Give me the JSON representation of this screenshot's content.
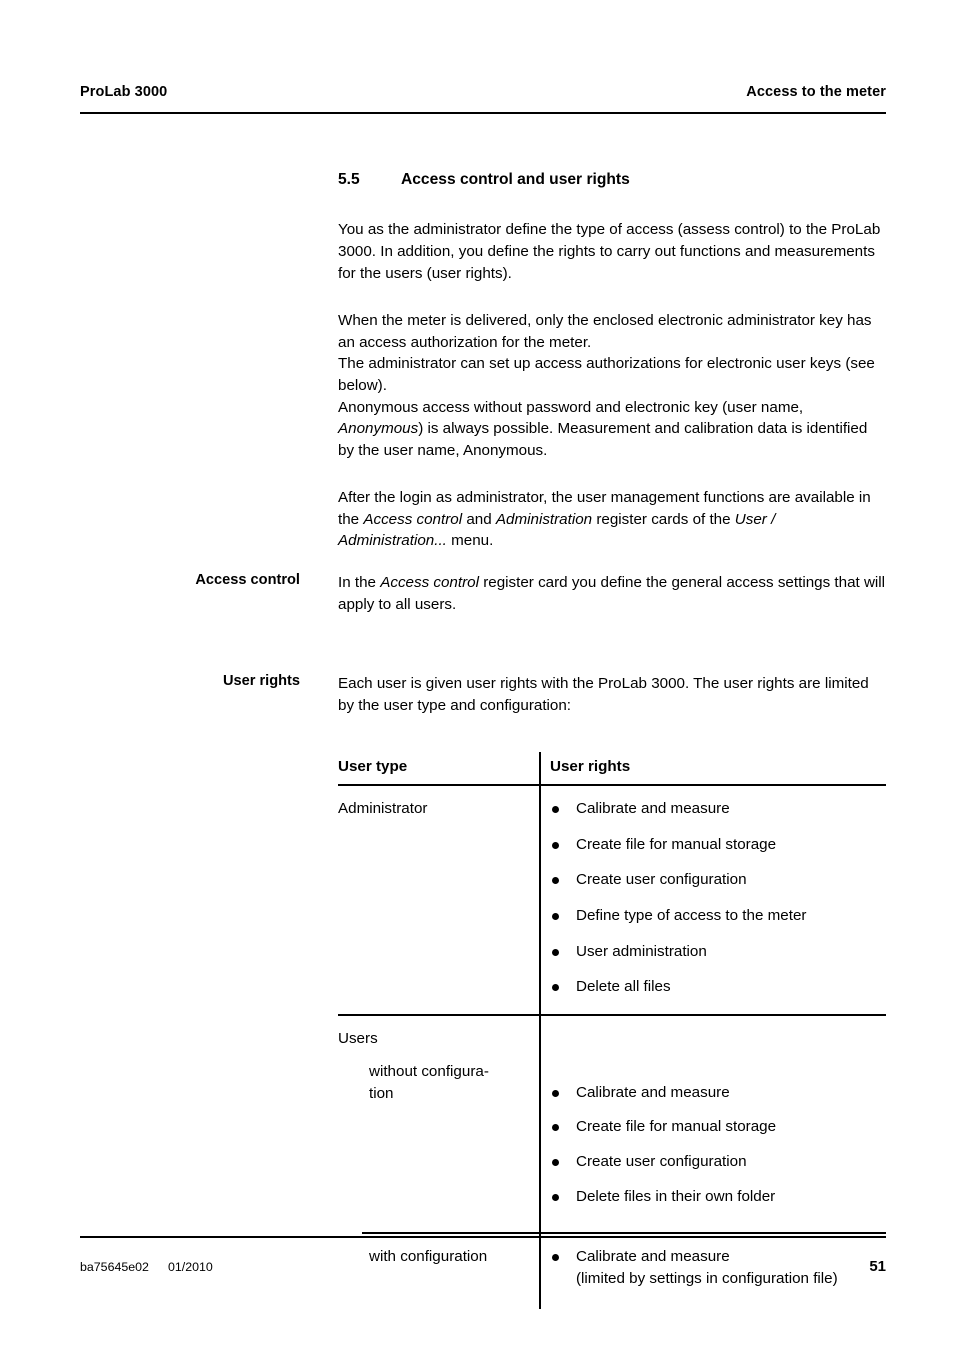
{
  "header": {
    "left": "ProLab 3000",
    "right": "Access to the meter"
  },
  "section": {
    "number": "5.5",
    "title": "Access control and user rights"
  },
  "paragraphs": {
    "p1": "You as the administrator define the type of access (assess control) to the ProLab 3000. In addition, you define the rights to carry out functions and measurements for the users (user rights).",
    "p2_line1": "When the meter is delivered, only the enclosed electronic administrator key has an access authorization for the meter.",
    "p2_line2": "The administrator can set up access authorizations for electronic user keys (see below).",
    "p2_line3_a": "Anonymous access without password and electronic key (user name, ",
    "p2_line3_em": "Anonymous",
    "p2_line3_b": ") is always possible. Measurement and calibration data is identified by the user name, Anonymous.",
    "p3_a": "After the login as administrator, the user management functions are available in the ",
    "p3_em1": "Access control",
    "p3_b": " and ",
    "p3_em2": "Administration",
    "p3_c": " register cards of the ",
    "p3_em3": "User  / Administration...",
    "p3_d": " menu."
  },
  "blocks": {
    "access_control": {
      "label": "Access control",
      "text_a": "In the ",
      "text_em": "Access control",
      "text_b": " register card you define the general access settings that will apply to all users."
    },
    "user_rights": {
      "label": "User rights",
      "text": "Each user is given user rights with the ProLab 3000. The user rights are limited by the user type and configuration:"
    }
  },
  "table": {
    "headers": {
      "user_type": "User type",
      "user_rights": "User rights"
    },
    "rows": [
      {
        "type": "Administrator",
        "rights": [
          "Calibrate and measure",
          "Create file for manual storage",
          "Create user configuration",
          "Define type of access to the meter",
          "User administration",
          "Delete all files"
        ]
      },
      {
        "type": "Users",
        "subtype": "without configura-tion",
        "subtype_line1": "without configura-",
        "subtype_line2": "tion",
        "rights": [
          "Calibrate and measure",
          "Create file for manual storage",
          "Create user configuration",
          "Delete files in their own folder"
        ]
      },
      {
        "subtype": "with configuration",
        "rights_line1": "Calibrate and measure",
        "rights_line2": "(limited by settings in configuration file)"
      }
    ]
  },
  "footer": {
    "doc_id": "ba75645e02",
    "date": "01/2010",
    "page_number": "51"
  }
}
